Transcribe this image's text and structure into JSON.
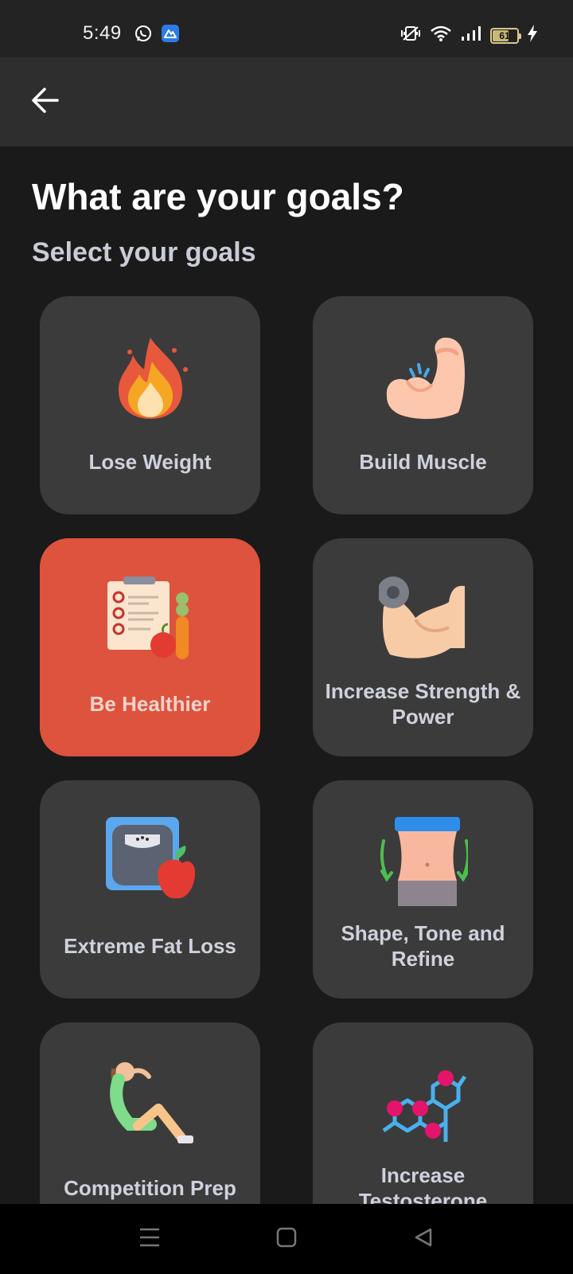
{
  "status_bar": {
    "time": "5:49",
    "battery_level": "61",
    "left_icons": [
      "whatsapp-icon",
      "app-notification-icon"
    ],
    "right_icons": [
      "vibrate-icon",
      "wifi-icon",
      "signal-icon",
      "battery-icon",
      "charging-icon"
    ]
  },
  "header": {
    "back_icon": "arrow-left-icon"
  },
  "main": {
    "title": "What are your goals?",
    "subtitle": "Select your goals",
    "goals": [
      {
        "label": "Lose Weight",
        "icon": "fire-icon",
        "selected": false
      },
      {
        "label": "Build Muscle",
        "icon": "flexed-arm-icon",
        "selected": false
      },
      {
        "label": "Be Healthier",
        "icon": "checklist-food-icon",
        "selected": true
      },
      {
        "label": "Increase Strength & Power",
        "icon": "arm-dumbbell-icon",
        "selected": false
      },
      {
        "label": "Extreme Fat Loss",
        "icon": "scale-apple-icon",
        "selected": false
      },
      {
        "label": "Shape, Tone and Refine",
        "icon": "waist-icon",
        "selected": false
      },
      {
        "label": "Competition Prep",
        "icon": "situp-icon",
        "selected": false
      },
      {
        "label": "Increase Testosterone",
        "icon": "molecule-icon",
        "selected": false
      }
    ]
  },
  "colors": {
    "background": "#1a1a1a",
    "card": "#3b3b3b",
    "selected_card": "#dd533d",
    "label": "#cfd2dc"
  },
  "nav_bar": {
    "buttons": [
      "menu-icon",
      "home-icon",
      "back-triangle-icon"
    ]
  }
}
